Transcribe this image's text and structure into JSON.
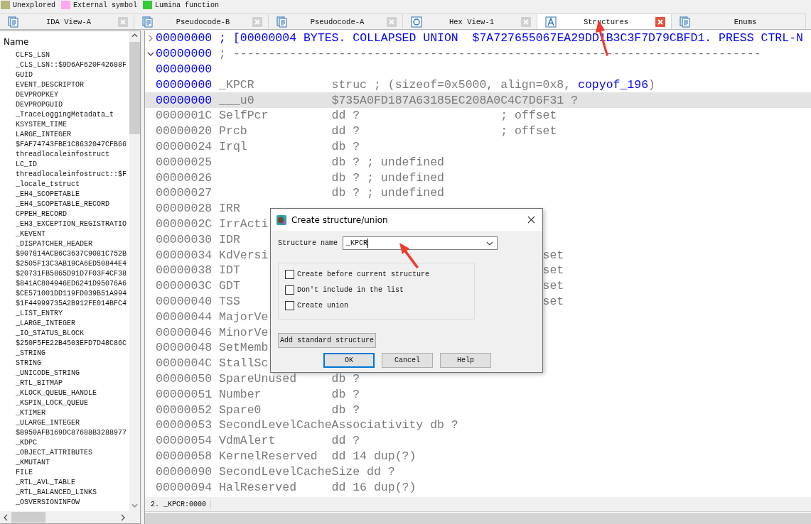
{
  "legend": [
    {
      "label": "Unexplored",
      "color": "#b8b57c"
    },
    {
      "label": "External symbol",
      "color": "#ffa8f0"
    },
    {
      "label": "Lumina function",
      "color": "#33cc33"
    }
  ],
  "tabs": [
    {
      "label": "IDA View-A",
      "kind": "document",
      "selected": false,
      "closable": true
    },
    {
      "label": "Pseudocode-B",
      "kind": "document",
      "selected": false,
      "closable": true
    },
    {
      "label": "Pseudocode-A",
      "kind": "document",
      "selected": false,
      "closable": true
    },
    {
      "label": "Hex View-1",
      "kind": "hex",
      "selected": false,
      "closable": true
    },
    {
      "label": "Structures",
      "kind": "structure",
      "selected": true,
      "closable": true
    },
    {
      "label": "Enums",
      "kind": "document",
      "selected": false,
      "closable": false
    }
  ],
  "sidebar": {
    "header": "Name",
    "items": [
      "CLFS_LSN",
      "_CLS_LSN::$9D6AF620F42688F",
      "GUID",
      "EVENT_DESCRIPTOR",
      "DEVPROPKEY",
      "DEVPROPGUID",
      "_TraceLoggingMetadata_t",
      "KSYSTEM_TIME",
      "LARGE_INTEGER",
      "$FAF74743FBE1C8632047CFB66",
      "threadlocaleinfostruct",
      "LC_ID",
      "threadlocaleinfostruct::$F",
      "_locale_tstruct",
      "_EH4_SCOPETABLE",
      "_EH4_SCOPETABLE_RECORD",
      "CPPEH_RECORD",
      "_EH3_EXCEPTION_REGISTRATIO",
      "_KEVENT",
      "_DISPATCHER_HEADER",
      "$907814ACB6C3637C9081C752B",
      "$2505F13C3AB19CA6ED50844E4",
      "$20731FB5865D91D7F03F4CF38",
      "$841AC804946ED6241D95076A6",
      "$CE571001DD119FD039B51A994",
      "$1F44999735A2B912FE014BFC4",
      "_LIST_ENTRY",
      "_LARGE_INTEGER",
      "_IO_STATUS_BLOCK",
      "$250F5FE22B4503EFD7D48C86C",
      "_STRING",
      "STRING",
      "_UNICODE_STRING",
      "_RTL_BITMAP",
      "_KLOCK_QUEUE_HANDLE",
      "_KSPIN_LOCK_QUEUE",
      "_KTIMER",
      "_ULARGE_INTEGER",
      "$B950AFB169DC87688B3288977",
      "_KDPC",
      "_OBJECT_ATTRIBUTES",
      "_KMUTANT",
      "FILE",
      "_RTL_AVL_TABLE",
      "_RTL_BALANCED_LINKS",
      "_OSVERSIONINFOW"
    ]
  },
  "listing": {
    "rows": [
      {
        "kind": "collapsed",
        "address": "00000000",
        "selected": false,
        "text": "; [00000004 BYTES. COLLAPSED UNION  $7A727655067EA29DD1B3C3F7D79CBFD1. PRESS CTRL-N"
      },
      {
        "kind": "separator",
        "address": "00000000",
        "selected": false,
        "text": "; ---------------------------------------------------------------------------"
      },
      {
        "kind": "blank",
        "address": "00000000",
        "selected": false
      },
      {
        "kind": "header",
        "address": "00000000",
        "selected": false,
        "name": "_KPCR",
        "type": "struc ; (sizeof=0x5000, align=0x8,",
        "ref": "copyof_196",
        "type_end": ")"
      },
      {
        "kind": "member",
        "address": "00000000",
        "selected": true,
        "name": "___u0",
        "type": "$735A0FD187A63185EC208A0C4C7D6F31 ?"
      },
      {
        "kind": "member",
        "address": "0000001C",
        "selected": false,
        "name": "SelfPcr",
        "type": "dd ?",
        "comment": "; offset"
      },
      {
        "kind": "member",
        "address": "00000020",
        "selected": false,
        "name": "Prcb",
        "type": "dd ?",
        "comment": "; offset"
      },
      {
        "kind": "member",
        "address": "00000024",
        "selected": false,
        "name": "Irql",
        "type": "db ?"
      },
      {
        "kind": "member",
        "address": "00000025",
        "selected": false,
        "type": "db ? ; undefined"
      },
      {
        "kind": "member",
        "address": "00000026",
        "selected": false,
        "type": "db ? ; undefined"
      },
      {
        "kind": "member",
        "address": "00000027",
        "selected": false,
        "type": "db ? ; undefined"
      },
      {
        "kind": "member",
        "address": "00000028",
        "selected": false,
        "name": "IRR"
      },
      {
        "kind": "fragment",
        "address": "0000002C",
        "selected": false,
        "name": "IrrActi"
      },
      {
        "kind": "fragment",
        "address": "00000030",
        "selected": false,
        "name": "IDR"
      },
      {
        "kind": "fragment",
        "address": "00000034",
        "selected": false,
        "name": "KdVersi",
        "comment": "set"
      },
      {
        "kind": "fragment",
        "address": "00000038",
        "selected": false,
        "name": "IDT",
        "comment": "set"
      },
      {
        "kind": "fragment",
        "address": "0000003C",
        "selected": false,
        "name": "GDT",
        "comment": "set"
      },
      {
        "kind": "fragment",
        "address": "00000040",
        "selected": false,
        "name": "TSS",
        "comment": "set"
      },
      {
        "kind": "fragment",
        "address": "00000044",
        "selected": false,
        "name": "MajorVe"
      },
      {
        "kind": "fragment",
        "address": "00000046",
        "selected": false,
        "name": "MinorVe"
      },
      {
        "kind": "fragment",
        "address": "00000048",
        "selected": false,
        "name": "SetMemb"
      },
      {
        "kind": "fragment",
        "address": "0000004C",
        "selected": false,
        "name": "StallSc"
      },
      {
        "kind": "member",
        "address": "00000050",
        "selected": false,
        "name": "SpareUnused",
        "type": "db ?"
      },
      {
        "kind": "member",
        "address": "00000051",
        "selected": false,
        "name": "Number",
        "type": "db ?"
      },
      {
        "kind": "member",
        "address": "00000052",
        "selected": false,
        "name": "Spare0",
        "type": "db ?"
      },
      {
        "kind": "member",
        "address": "00000053",
        "selected": false,
        "name": "SecondLevelCacheAssociativity",
        "type": "db ?"
      },
      {
        "kind": "member",
        "address": "00000054",
        "selected": false,
        "name": "VdmAlert",
        "type": "dd ?"
      },
      {
        "kind": "member",
        "address": "00000058",
        "selected": false,
        "name": "KernelReserved",
        "type": "dd 14 dup(?)"
      },
      {
        "kind": "member",
        "address": "00000090",
        "selected": false,
        "name": "SecondLevelCacheSize",
        "type": "dd ?"
      },
      {
        "kind": "member",
        "address": "00000094",
        "selected": false,
        "name": "HalReserved",
        "type": "dd 16 dup(?)"
      }
    ]
  },
  "status_bar": {
    "text": "2. _KPCR:0000"
  },
  "dialog": {
    "title": "Create structure/union",
    "field_label": "Structure name",
    "field_value": "_KPCR",
    "options": [
      {
        "label": "Create before current structure",
        "checked": false
      },
      {
        "label": "Don't include in the list",
        "checked": false
      },
      {
        "label": "Create union",
        "checked": false
      }
    ],
    "extra_button": "Add standard structure",
    "buttons": [
      {
        "label": "OK",
        "default": true
      },
      {
        "label": "Cancel",
        "default": false
      },
      {
        "label": "Help",
        "default": false
      }
    ]
  }
}
